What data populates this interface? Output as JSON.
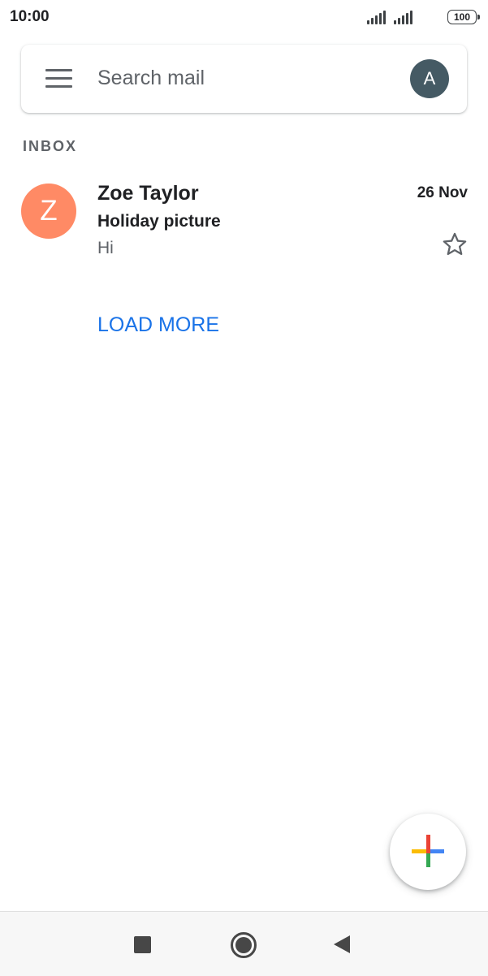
{
  "status_bar": {
    "time": "10:00",
    "battery": "100"
  },
  "search": {
    "placeholder": "Search mail",
    "account_initial": "A"
  },
  "inbox": {
    "label": "INBOX",
    "emails": [
      {
        "avatar_letter": "Z",
        "avatar_color": "#ff8a65",
        "sender": "Zoe Taylor",
        "date": "26 Nov",
        "subject": "Holiday picture",
        "snippet": "Hi",
        "starred": false
      }
    ],
    "load_more_label": "LOAD MORE"
  },
  "icons": {
    "menu": "menu-icon",
    "star": "star-outline-icon",
    "compose": "compose-plus-icon",
    "nav_recents": "recents-square-icon",
    "nav_home": "home-circle-icon",
    "nav_back": "back-triangle-icon"
  },
  "colors": {
    "accent": "#1a73e8",
    "account_avatar": "#455a64",
    "compose_red": "#ea4335",
    "compose_blue": "#4285f4",
    "compose_green": "#34a853",
    "compose_yellow": "#fbbc04"
  }
}
